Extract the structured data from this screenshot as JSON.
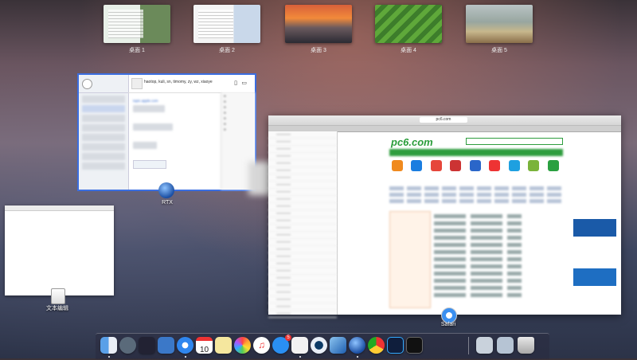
{
  "desktops": [
    {
      "label": "桌面 1"
    },
    {
      "label": "桌面 2"
    },
    {
      "label": "桌面 3"
    },
    {
      "label": "桌面 4"
    },
    {
      "label": "桌面 5"
    }
  ],
  "windows": {
    "rtx": {
      "app_label": "RTX",
      "title": "haotop, kuli, sn, timomy, zy, wz, xiaoye",
      "chat_link": "topic.apple.com"
    },
    "safari": {
      "app_label": "Safari",
      "url": "pc6.com",
      "site_logo": "pc6.com"
    },
    "textedit": {
      "app_label": "文本编辑"
    }
  },
  "dock": {
    "items": [
      "finder-icon",
      "launchpad-icon",
      "mission-control-icon",
      "preview-icon",
      "safari-icon",
      "calendar-icon",
      "notes-icon",
      "photos-icon",
      "itunes-icon",
      "app-store-icon",
      "textedit-icon",
      "quicktime-icon",
      "xcode-icon",
      "rtx-icon",
      "chrome-icon",
      "photoshop-icon",
      "terminal-icon",
      "downloads-icon",
      "applications-icon",
      "trash-icon"
    ],
    "calendar_day": "10",
    "appstore_badge": "5"
  }
}
